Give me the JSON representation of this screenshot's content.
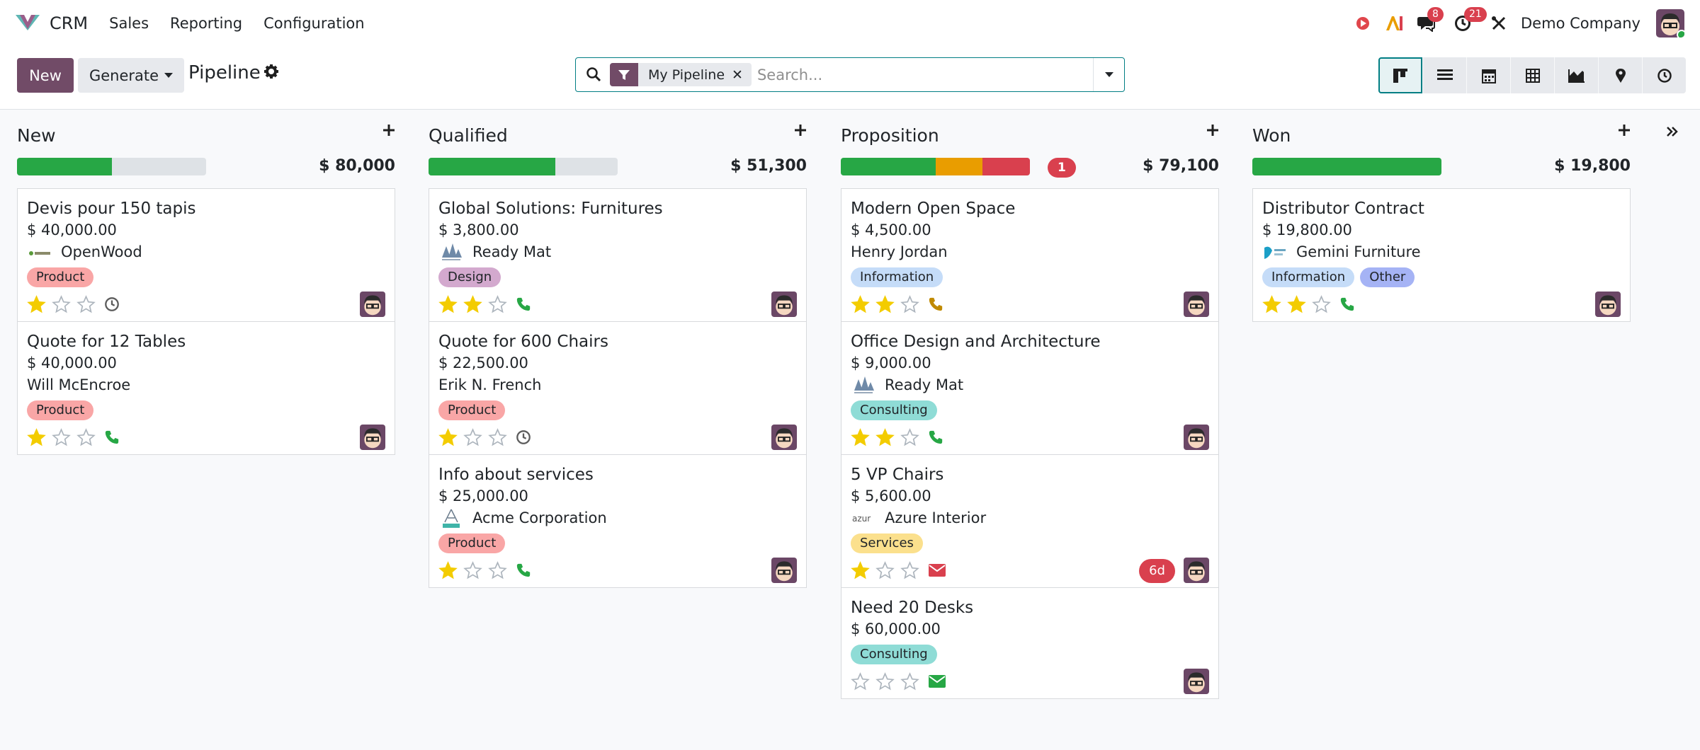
{
  "app": {
    "name": "CRM"
  },
  "menu": [
    "Sales",
    "Reporting",
    "Configuration"
  ],
  "systray": {
    "messages_count": "8",
    "activities_count": "21",
    "company": "Demo Company"
  },
  "control": {
    "new_label": "New",
    "generate_label": "Generate",
    "title": "Pipeline",
    "filter_facet": "My Pipeline",
    "search_placeholder": "Search..."
  },
  "views": [
    "kanban-icon",
    "list-icon",
    "calendar-icon",
    "pivot-icon",
    "graph-icon",
    "map-icon",
    "activity-icon"
  ],
  "columns": [
    {
      "title": "New",
      "total": "$ 80,000",
      "progress": {
        "green": 0.5,
        "orange": 0,
        "red": 0
      },
      "cards": [
        {
          "title": "Devis pour 150 tapis",
          "amount": "$ 40,000.00",
          "company": "OpenWood",
          "logo": "openwood-logo",
          "tags": [
            {
              "label": "Product",
              "color": "#f9a6a6"
            }
          ],
          "stars": 1,
          "activity": "clock-icon"
        },
        {
          "title": "Quote for 12 Tables",
          "amount": "$ 40,000.00",
          "company": "Will McEncroe",
          "logo": "",
          "tags": [
            {
              "label": "Product",
              "color": "#f9a6a6"
            }
          ],
          "stars": 1,
          "activity": "phone-icon"
        }
      ]
    },
    {
      "title": "Qualified",
      "total": "$ 51,300",
      "progress": {
        "green": 0.67,
        "orange": 0,
        "red": 0
      },
      "cards": [
        {
          "title": "Global Solutions: Furnitures",
          "amount": "$ 3,800.00",
          "company": "Ready Mat",
          "logo": "readymat-logo",
          "tags": [
            {
              "label": "Design",
              "color": "#d3a9ce"
            }
          ],
          "stars": 2,
          "activity": "phone-icon"
        },
        {
          "title": "Quote for 600 Chairs",
          "amount": "$ 22,500.00",
          "company": "Erik N. French",
          "logo": "",
          "tags": [
            {
              "label": "Product",
              "color": "#f9a6a6"
            }
          ],
          "stars": 1,
          "activity": "clock-icon"
        },
        {
          "title": "Info about services",
          "amount": "$ 25,000.00",
          "company": "Acme Corporation",
          "logo": "acme-logo",
          "tags": [
            {
              "label": "Product",
              "color": "#f9a6a6"
            }
          ],
          "stars": 1,
          "activity": "phone-icon"
        }
      ]
    },
    {
      "title": "Proposition",
      "total": "$ 79,100",
      "count_badge": "1",
      "progress": {
        "green": 0.5,
        "orange": 0.25,
        "red": 0.25
      },
      "cards": [
        {
          "title": "Modern Open Space",
          "amount": "$ 4,500.00",
          "company": "Henry Jordan",
          "logo": "",
          "tags": [
            {
              "label": "Information",
              "color": "#c5dcf8"
            }
          ],
          "stars": 2,
          "activity": "phone-icon-warning"
        },
        {
          "title": "Office Design and Architecture",
          "amount": "$ 9,000.00",
          "company": "Ready Mat",
          "logo": "readymat-logo",
          "tags": [
            {
              "label": "Consulting",
              "color": "#8fdcd6"
            }
          ],
          "stars": 2,
          "activity": "phone-icon"
        },
        {
          "title": "5 VP Chairs",
          "amount": "$ 5,600.00",
          "company": "Azure Interior",
          "logo": "azure-logo",
          "tags": [
            {
              "label": "Services",
              "color": "#fbe08d"
            }
          ],
          "stars": 1,
          "activity": "envelope-icon-overdue",
          "late": "6d"
        },
        {
          "title": "Need 20 Desks",
          "amount": "$ 60,000.00",
          "company": "",
          "logo": "",
          "tags": [
            {
              "label": "Consulting",
              "color": "#8fdcd6"
            }
          ],
          "stars": 0,
          "activity": "envelope-icon"
        }
      ]
    },
    {
      "title": "Won",
      "total": "$ 19,800",
      "progress": {
        "green": 1,
        "orange": 0,
        "red": 0
      },
      "cards": [
        {
          "title": "Distributor Contract",
          "amount": "$ 19,800.00",
          "company": "Gemini Furniture",
          "logo": "gemini-logo",
          "tags": [
            {
              "label": "Information",
              "color": "#c5dcf8"
            },
            {
              "label": "Other",
              "color": "#a5b3f5"
            }
          ],
          "stars": 2,
          "activity": "phone-icon"
        }
      ]
    }
  ],
  "colors": {
    "brand": "#714b67",
    "accent": "#017e84",
    "success": "#27a745",
    "warning": "#e99d00",
    "danger": "#d9404e",
    "star": "#f3cc00"
  }
}
